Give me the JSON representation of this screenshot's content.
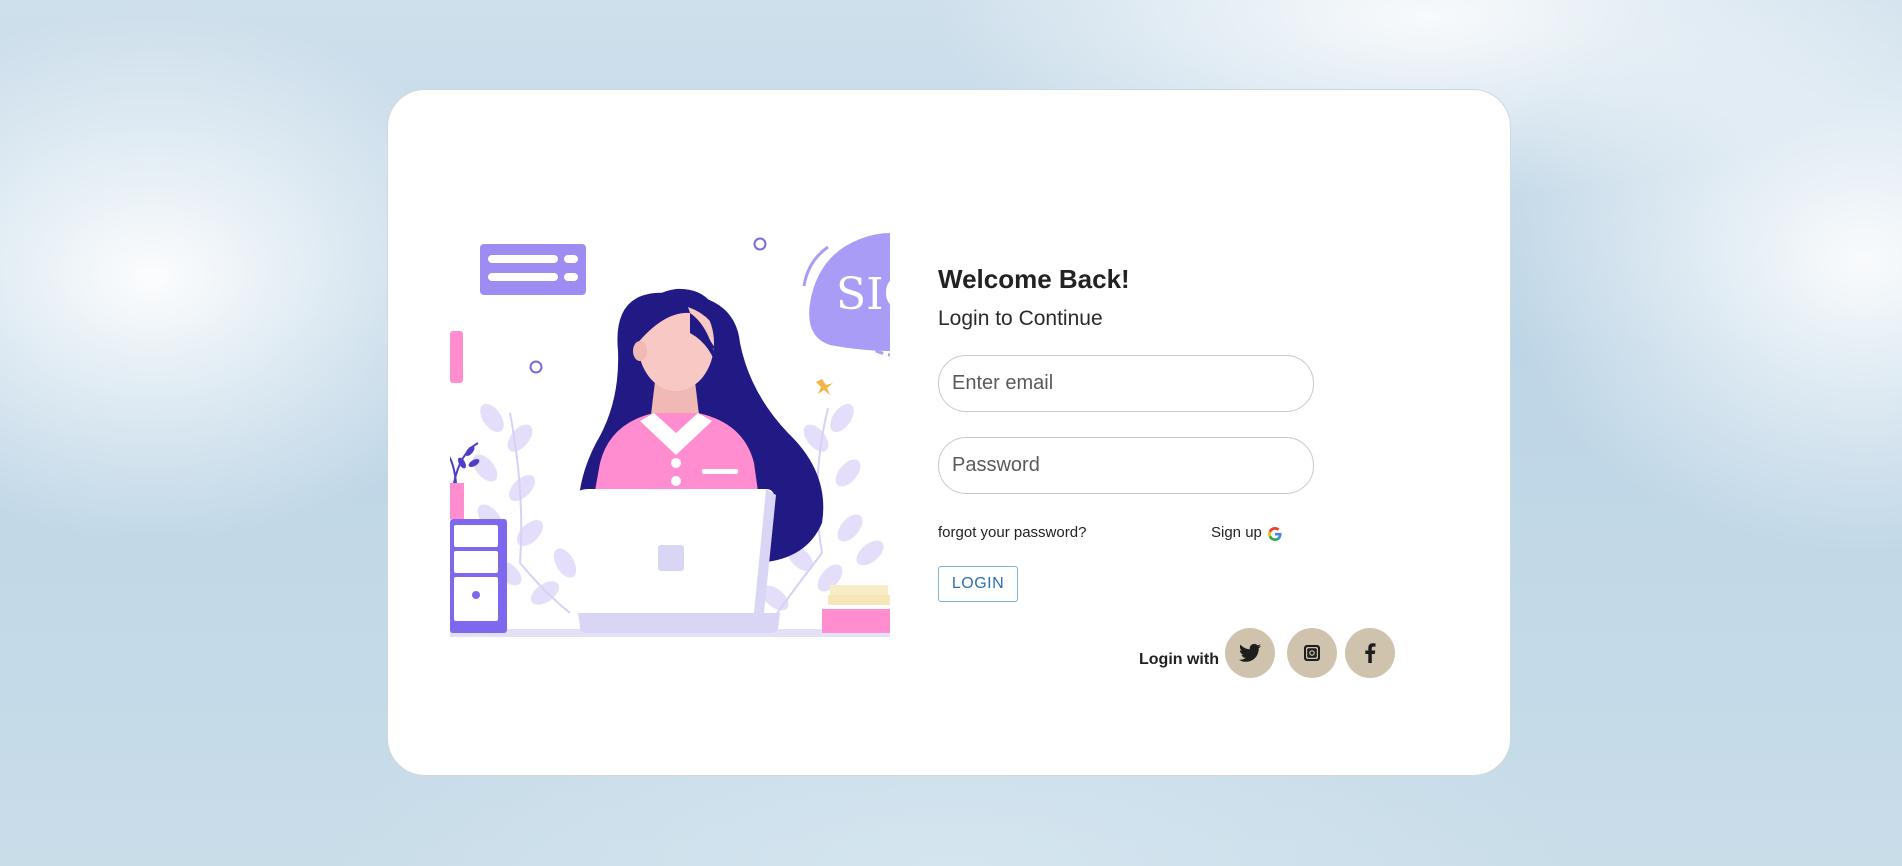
{
  "login": {
    "title": "Welcome Back!",
    "subtitle": "Login to Continue",
    "email_placeholder": "Enter email",
    "password_placeholder": "Password",
    "forgot_label": "forgot your password?",
    "signup_label": "Sign up",
    "login_button": "LOGIN",
    "social_label": "Login with",
    "social_icons": [
      "twitter-icon",
      "instagram-icon",
      "facebook-icon"
    ]
  },
  "illustration": {
    "sign_text": "SIG"
  },
  "colors": {
    "social_button_bg": "#cfc3ad",
    "login_button_text": "#2b70b5",
    "login_button_border": "#7fb2dd",
    "card_bg": "#ffffff"
  }
}
